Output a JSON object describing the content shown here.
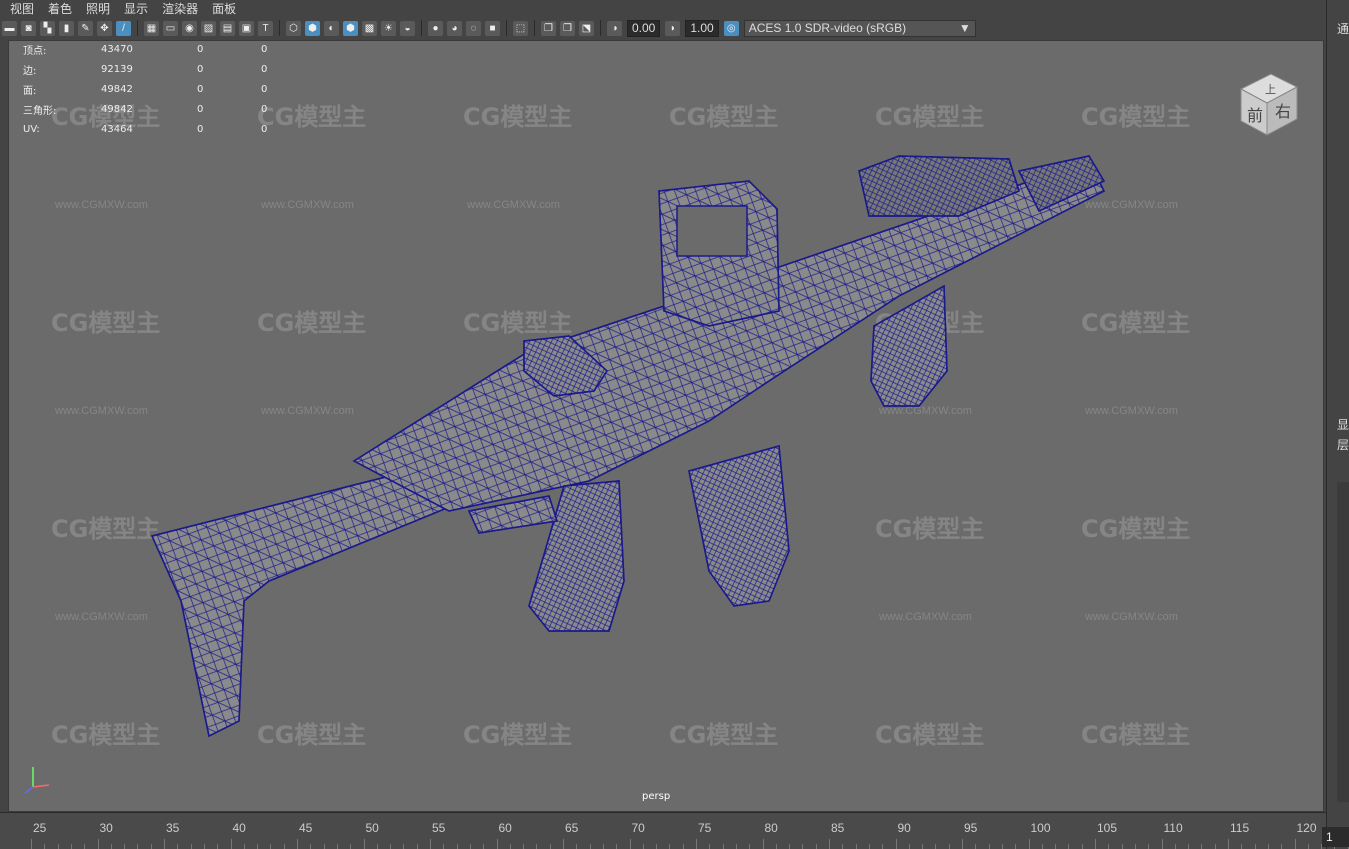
{
  "menu": [
    "视图",
    "着色",
    "照明",
    "显示",
    "渲染器",
    "面板"
  ],
  "toolbar": {
    "exposure_value": "0.00",
    "gamma_value": "1.00",
    "colorspace_value": "ACES 1.0 SDR-video (sRGB)",
    "accent_color": "#4a8fc0"
  },
  "hud": [
    {
      "label": "顶点:",
      "value": "43470",
      "a": "0",
      "b": "0"
    },
    {
      "label": "边:",
      "value": "92139",
      "a": "0",
      "b": "0"
    },
    {
      "label": "面:",
      "value": "49842",
      "a": "0",
      "b": "0"
    },
    {
      "label": "三角形:",
      "value": "49842",
      "a": "0",
      "b": "0"
    },
    {
      "label": "UV:",
      "value": "43464",
      "a": "0",
      "b": "0"
    }
  ],
  "viewport": {
    "camera_label": "persp",
    "background_color": "#6b6b6b",
    "wireframe_color": "#1a1a8c"
  },
  "viewcube": {
    "top": "上",
    "front": "前",
    "right": "右"
  },
  "watermark": {
    "logo": "CG模型主",
    "url": "www.CGMXW.com"
  },
  "right_panel": {
    "top_text": "通",
    "mid_text_1": "显",
    "mid_text_2": "层"
  },
  "timeline": {
    "ticks": [
      "25",
      "30",
      "35",
      "40",
      "45",
      "50",
      "55",
      "60",
      "65",
      "70",
      "75",
      "80",
      "85",
      "90",
      "95",
      "100",
      "105",
      "110",
      "115",
      "120"
    ],
    "current_frame": "1"
  }
}
